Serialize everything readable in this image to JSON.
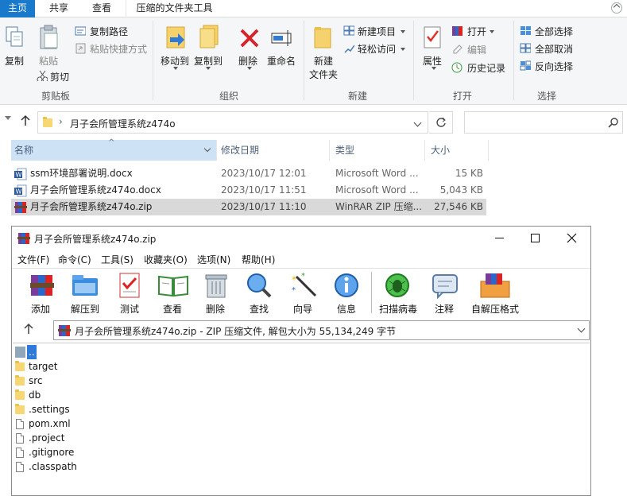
{
  "ribbon_tabs": {
    "home": "主页",
    "share": "共享",
    "view": "查看",
    "compressed_tools": "压缩的文件夹工具"
  },
  "clipboard": {
    "copy": "复制",
    "paste": "粘贴",
    "copy_path": "复制路径",
    "paste_shortcut": "粘贴快捷方式",
    "cut": "剪切",
    "group_label": "剪贴板"
  },
  "organize": {
    "move_to": "移动到",
    "copy_to": "复制到",
    "delete": "删除",
    "rename": "重命名",
    "group_label": "组织"
  },
  "new_group": {
    "new_folder_line1": "新建",
    "new_folder_line2": "文件夹",
    "new_item": "新建项目",
    "easy_access": "轻松访问",
    "group_label": "新建"
  },
  "open_group": {
    "properties": "属性",
    "open": "打开",
    "edit": "编辑",
    "history": "历史记录",
    "group_label": "打开"
  },
  "select_group": {
    "select_all": "全部选择",
    "select_none": "全部取消",
    "invert": "反向选择",
    "group_label": "选择"
  },
  "address": {
    "path": "月子会所管理系统z474o"
  },
  "columns": {
    "name": "名称",
    "modified": "修改日期",
    "type": "类型",
    "size": "大小"
  },
  "files": [
    {
      "name": "ssm环境部署说明.docx",
      "modified": "2023/10/17 12:01",
      "type": "Microsoft Word ...",
      "size": "15 KB"
    },
    {
      "name": "月子会所管理系统z474o.docx",
      "modified": "2023/10/17 11:51",
      "type": "Microsoft Word ...",
      "size": "5,043 KB"
    },
    {
      "name": "月子会所管理系统z474o.zip",
      "modified": "2023/10/17 11:10",
      "type": "WinRAR ZIP 压缩...",
      "size": "27,546 KB"
    }
  ],
  "rar": {
    "title": "月子会所管理系统z474o.zip",
    "menu": [
      "文件(F)",
      "命令(C)",
      "工具(S)",
      "收藏夹(O)",
      "选项(N)",
      "帮助(H)"
    ],
    "tools": [
      "添加",
      "解压到",
      "测试",
      "查看",
      "删除",
      "查找",
      "向导",
      "信息",
      "扫描病毒",
      "注释",
      "自解压格式"
    ],
    "path_text": "月子会所管理系统z474o.zip - ZIP 压缩文件, 解包大小为 55,134,249 字节",
    "entries": [
      {
        "name": "..",
        "kind": "up"
      },
      {
        "name": "target",
        "kind": "folder"
      },
      {
        "name": "src",
        "kind": "folder"
      },
      {
        "name": "db",
        "kind": "folder"
      },
      {
        "name": ".settings",
        "kind": "folder"
      },
      {
        "name": "pom.xml",
        "kind": "file"
      },
      {
        "name": ".project",
        "kind": "file"
      },
      {
        "name": ".gitignore",
        "kind": "file"
      },
      {
        "name": ".classpath",
        "kind": "file"
      }
    ]
  },
  "colors": {
    "accent": "#1979ca",
    "selection": "#d9d9d9",
    "folder": "#f7d774"
  }
}
